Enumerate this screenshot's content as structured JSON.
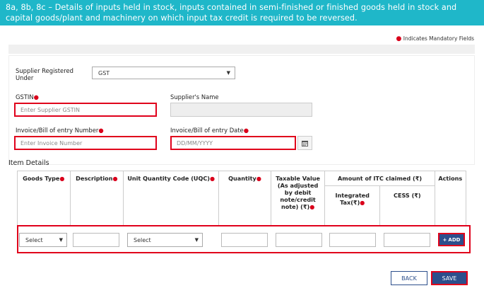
{
  "header": {
    "title": "8a, 8b, 8c – Details of inputs held in stock, inputs contained in semi-finished or finished goods held in stock and capital goods/plant and machinery on which input tax credit is required to be reversed."
  },
  "mandatory_note": "Indicates Mandatory Fields",
  "supplier_registered": {
    "label": "Supplier Registered Under",
    "value": "GST"
  },
  "gstin": {
    "label": "GSTIN",
    "placeholder": "Enter Supplier GSTIN"
  },
  "supplier_name": {
    "label": "Supplier's Name"
  },
  "invoice_number": {
    "label": "Invoice/Bill of entry Number",
    "placeholder": "Enter Invoice Number"
  },
  "invoice_date": {
    "label": "Invoice/Bill of entry Date",
    "placeholder": "DD/MM/YYYY"
  },
  "item_details": {
    "title": "Item Details",
    "columns": {
      "goods_type": "Goods Type",
      "description": "Description",
      "uqc": "Unit Quantity Code (UQC)",
      "quantity": "Quantity",
      "taxable_value": "Taxable Value (As adjusted by debit note/credit note) (₹)",
      "itc_claimed": "Amount of ITC claimed (₹)",
      "integrated_tax": "Integrated Tax(₹)",
      "cess": "CESS (₹)",
      "actions": "Actions"
    },
    "row": {
      "goods_type_value": "Select",
      "uqc_value": "Select"
    },
    "add_label": "ADD"
  },
  "buttons": {
    "back": "BACK",
    "save": "SAVE"
  },
  "colors": {
    "header_bg": "#1fb7c9",
    "primary": "#2c4f8c",
    "highlight": "#e0001b"
  }
}
